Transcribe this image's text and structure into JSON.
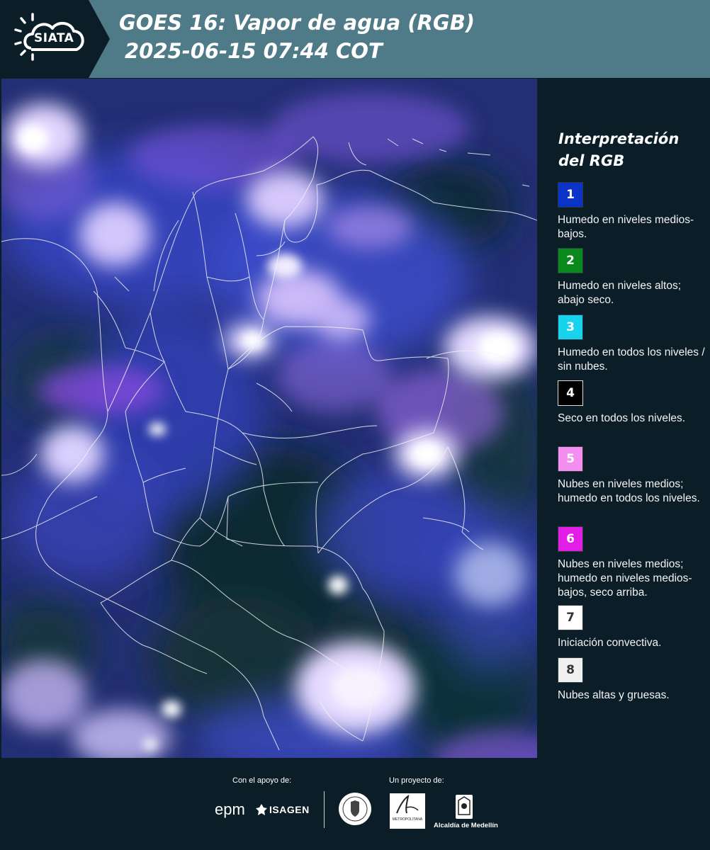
{
  "header": {
    "logo": "SIATA",
    "title_line1": "GOES 16: Vapor de agua (RGB)",
    "title_line2": "2025-06-15 07:44 COT"
  },
  "legend": {
    "title": "Interpretación del RGB",
    "items": [
      {
        "number": "1",
        "label": "Humedo en niveles medios-bajos.",
        "color": "#0b33c8",
        "text_color": "#ffffff"
      },
      {
        "number": "2",
        "label": "Humedo en niveles altos; abajo seco.",
        "color": "#0a8a1c",
        "text_color": "#ffffff"
      },
      {
        "number": "3",
        "label": "Humedo en todos los niveles / sin nubes.",
        "color": "#18d3ee",
        "text_color": "#ffffff"
      },
      {
        "number": "4",
        "label": "Seco en todos los niveles.",
        "color": "#000000",
        "text_color": "#ffffff"
      },
      {
        "number": "5",
        "label": "Nubes en niveles medios; humedo en todos los niveles.",
        "color": "#f48ef0",
        "text_color": "#ffffff"
      },
      {
        "number": "6",
        "label": "Nubes en niveles medios; humedo en niveles medios-bajos, seco arriba.",
        "color": "#e21ee6",
        "text_color": "#ffffff"
      },
      {
        "number": "7",
        "label": "Iniciación convectiva.",
        "color": "#ffffff",
        "text_color": "#333333"
      },
      {
        "number": "8",
        "label": "Nubes altas y gruesas.",
        "color": "#f0f0f0",
        "text_color": "#333333"
      }
    ]
  },
  "footer": {
    "support_label": "Con el apoyo de:",
    "project_label": "Un proyecto de:",
    "epm_logo": "epm",
    "isagen_logo": "ISAGEN",
    "area_logo": "METROPOLITANA",
    "alcaldia_logo": "Alcaldía de Medellín"
  }
}
